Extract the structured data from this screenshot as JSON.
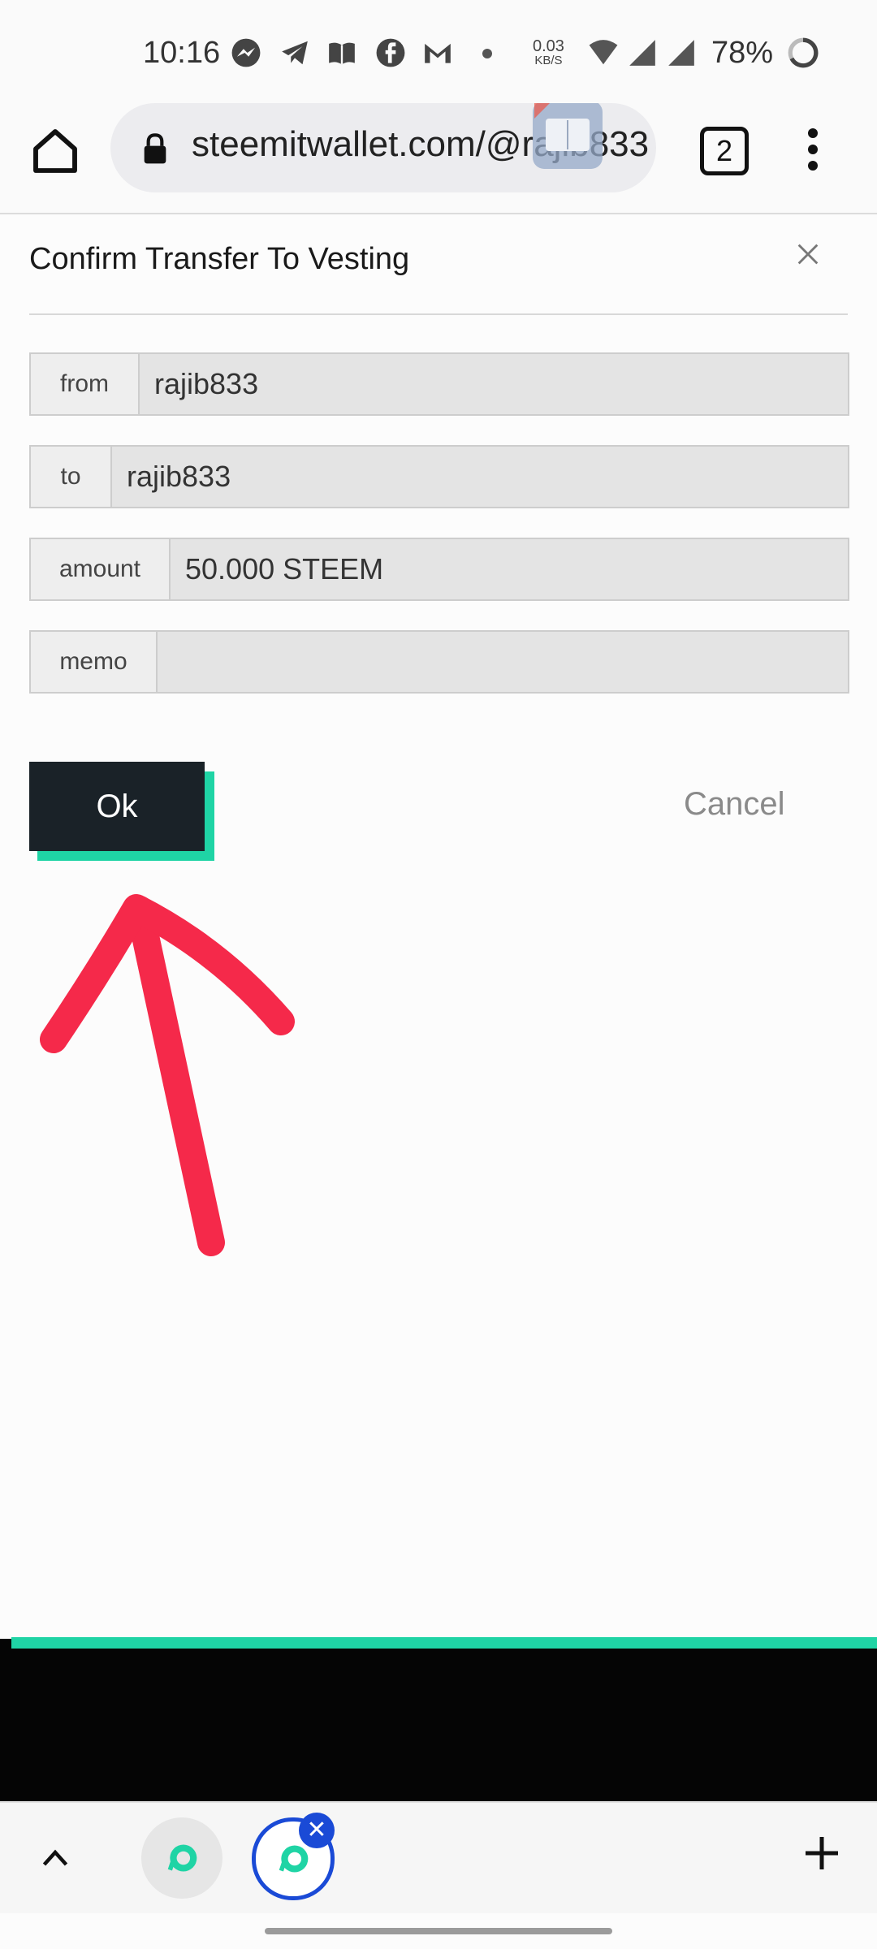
{
  "status_bar": {
    "time": "10:16",
    "net_speed": "0.03",
    "net_unit": "KB/S",
    "battery": "78%"
  },
  "browser": {
    "url": "steemitwallet.com/@rajib833",
    "tab_count": "2"
  },
  "dialog": {
    "title": "Confirm Transfer To Vesting",
    "fields": [
      {
        "label": "from",
        "value": "rajib833"
      },
      {
        "label": "to",
        "value": "rajib833"
      },
      {
        "label": "amount",
        "value": "50.000 STEEM"
      },
      {
        "label": "memo",
        "value": ""
      }
    ],
    "ok_label": "Ok",
    "cancel_label": "Cancel"
  },
  "colors": {
    "accent": "#1fd4a5",
    "ok_button": "#1a2228",
    "annotation_arrow": "#f5294a",
    "active_tab_ring": "#1a4ad6"
  },
  "icons": [
    "messenger-icon",
    "telegram-icon",
    "book-icon",
    "facebook-icon",
    "gmail-icon",
    "wifi-icon",
    "signal-icon",
    "battery-icon",
    "home-icon",
    "lock-icon",
    "reader-icon",
    "tabs-icon",
    "more-icon",
    "close-icon",
    "chevron-up-icon",
    "chat-bubble-icon",
    "plus-icon"
  ]
}
